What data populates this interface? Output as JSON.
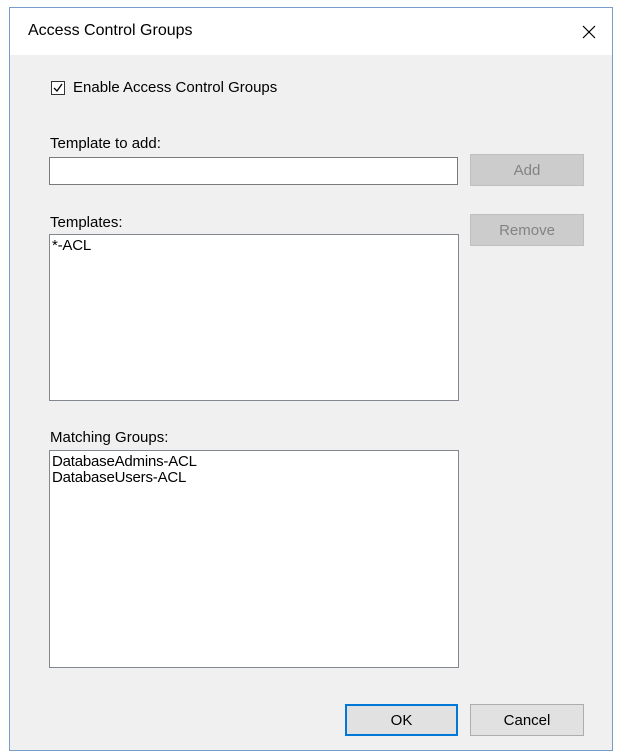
{
  "window": {
    "title": "Access Control Groups",
    "close_glyph": "✕"
  },
  "enable_checkbox": {
    "label": "Enable Access Control Groups",
    "checked": true
  },
  "template_to_add": {
    "label": "Template to add:",
    "value": ""
  },
  "add_button": {
    "label": "Add",
    "enabled": false
  },
  "templates": {
    "label": "Templates:",
    "items": [
      "*-ACL"
    ]
  },
  "remove_button": {
    "label": "Remove",
    "enabled": false
  },
  "matching_groups": {
    "label": "Matching Groups:",
    "items": [
      "DatabaseAdmins-ACL",
      "DatabaseUsers-ACL"
    ]
  },
  "footer": {
    "ok_label": "OK",
    "cancel_label": "Cancel"
  },
  "colors": {
    "dialog_bg": "#f0f0f0",
    "accent": "#0078d7",
    "disabled_text": "#838383"
  }
}
